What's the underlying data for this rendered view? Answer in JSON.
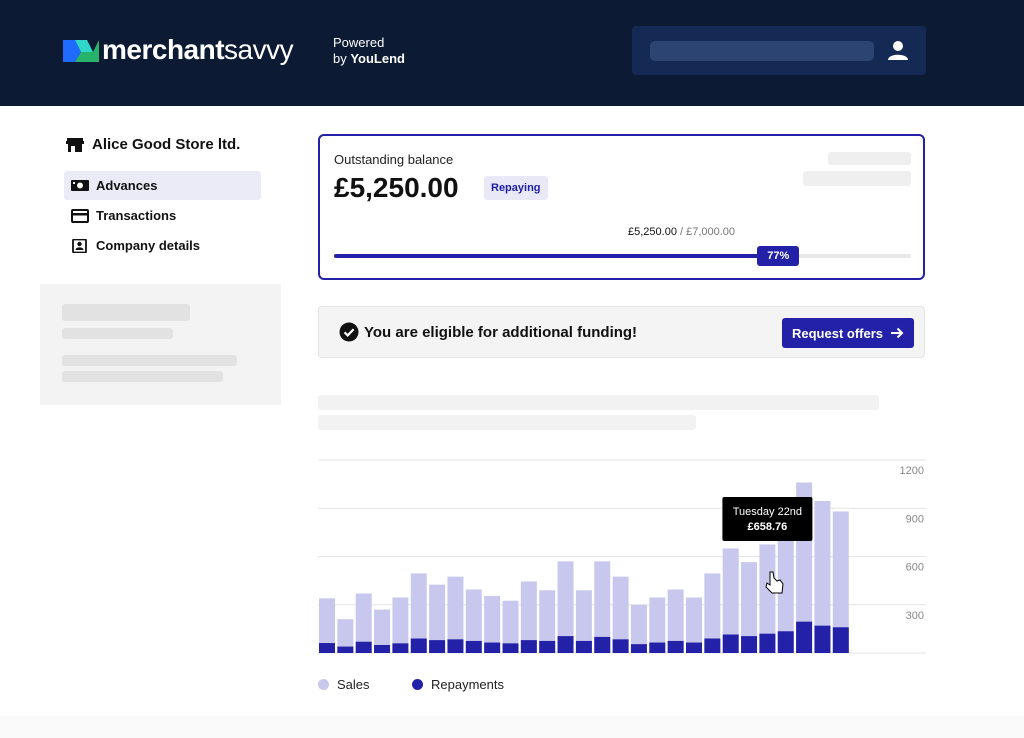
{
  "header": {
    "brand_bold": "merchant",
    "brand_light": "savvy",
    "powered_line1": "Powered",
    "powered_line2_prefix": "by ",
    "powered_line2_brand": "YouLend",
    "user_icon": "user-icon"
  },
  "sidebar": {
    "store_name": "Alice Good Store ltd.",
    "store_icon": "store-icon",
    "items": [
      {
        "label": "Advances",
        "icon": "banknote-icon",
        "active": true
      },
      {
        "label": "Transactions",
        "icon": "card-icon",
        "active": false
      },
      {
        "label": "Company details",
        "icon": "contact-card-icon",
        "active": false
      }
    ]
  },
  "balance": {
    "label": "Outstanding balance",
    "amount": "£5,250.00",
    "status": "Repaying",
    "progress_current": "£5,250.00",
    "progress_separator": " / ",
    "progress_total": "£7,000.00",
    "percent_label": "77%",
    "percent": 77
  },
  "eligibility": {
    "message": "You are eligible for additional funding!",
    "button_label": "Request offers",
    "icon": "check-circle-icon"
  },
  "colors": {
    "header_bg": "#0c1b33",
    "accent": "#2321a8",
    "sales": "#c8c8ee",
    "repayments": "#2321a8"
  },
  "chart_data": {
    "type": "bar",
    "stacked": false,
    "y_ticks": [
      300,
      600,
      900,
      1200
    ],
    "ylim": [
      0,
      1200
    ],
    "y_axis_side": "right",
    "grid": true,
    "legend_position": "bottom-left",
    "series": [
      {
        "name": "Sales",
        "values": [
          340,
          210,
          370,
          270,
          345,
          495,
          425,
          475,
          395,
          355,
          325,
          445,
          390,
          570,
          390,
          570,
          475,
          300,
          345,
          395,
          345,
          495,
          650,
          565,
          675,
          750,
          1060,
          945,
          880
        ]
      },
      {
        "name": "Repayments",
        "values": [
          62,
          40,
          70,
          50,
          60,
          90,
          80,
          85,
          75,
          65,
          60,
          80,
          75,
          105,
          75,
          100,
          85,
          55,
          65,
          75,
          65,
          90,
          115,
          105,
          120,
          135,
          195,
          170,
          160
        ]
      }
    ],
    "tooltip": {
      "index": 24,
      "title": "Tuesday 22nd",
      "value": "£658.76"
    }
  }
}
